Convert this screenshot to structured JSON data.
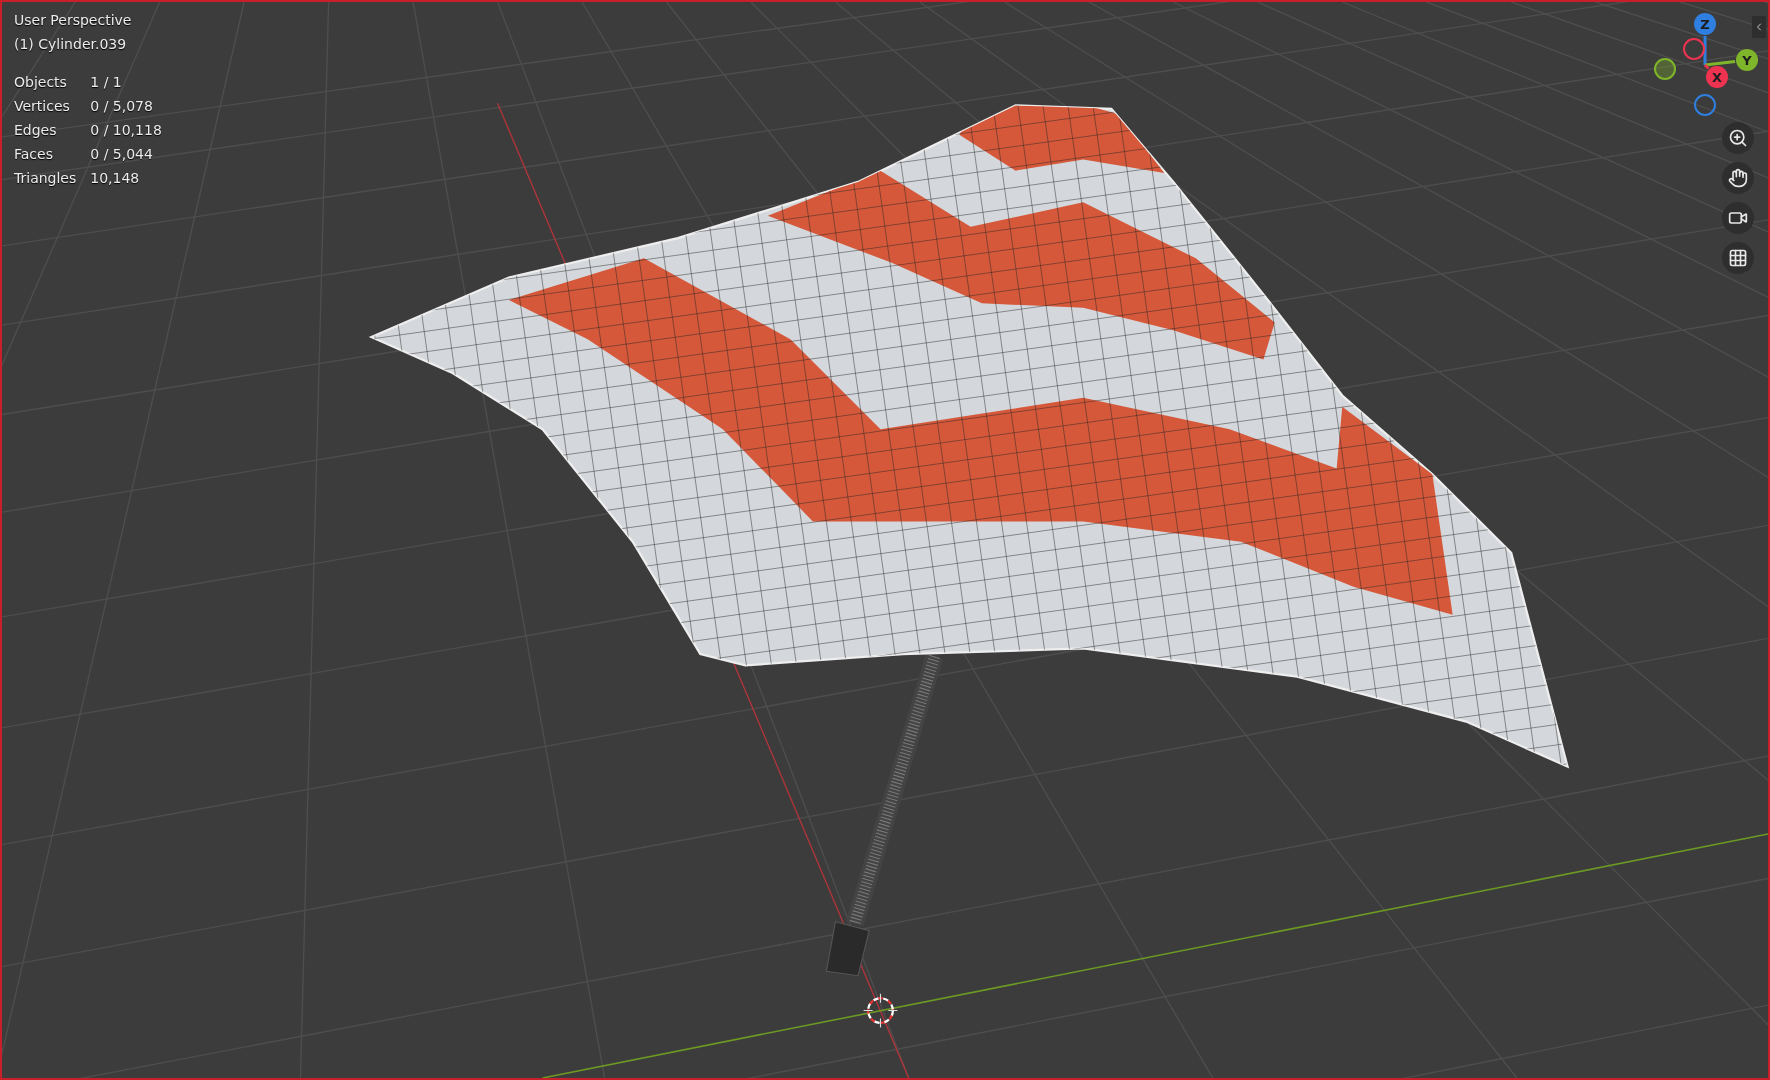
{
  "viewport": {
    "view_name": "User Perspective",
    "object_name": "(1) Cylinder.039",
    "stats": [
      {
        "label": "Objects",
        "value": "1 / 1"
      },
      {
        "label": "Vertices",
        "value": "0 / 5,078"
      },
      {
        "label": "Edges",
        "value": "0 / 10,118"
      },
      {
        "label": "Faces",
        "value": "0 / 5,044"
      },
      {
        "label": "Triangles",
        "value": "10,148"
      }
    ]
  },
  "gizmo": {
    "axes": [
      {
        "label": "Z",
        "color": "#2f7fe0"
      },
      {
        "label": "Y",
        "color": "#7fb52a"
      },
      {
        "label": "X",
        "color": "#ee3350"
      }
    ]
  },
  "nav_buttons": [
    {
      "kind": "zoom"
    },
    {
      "kind": "pan"
    },
    {
      "kind": "camera"
    },
    {
      "kind": "perspective"
    }
  ]
}
